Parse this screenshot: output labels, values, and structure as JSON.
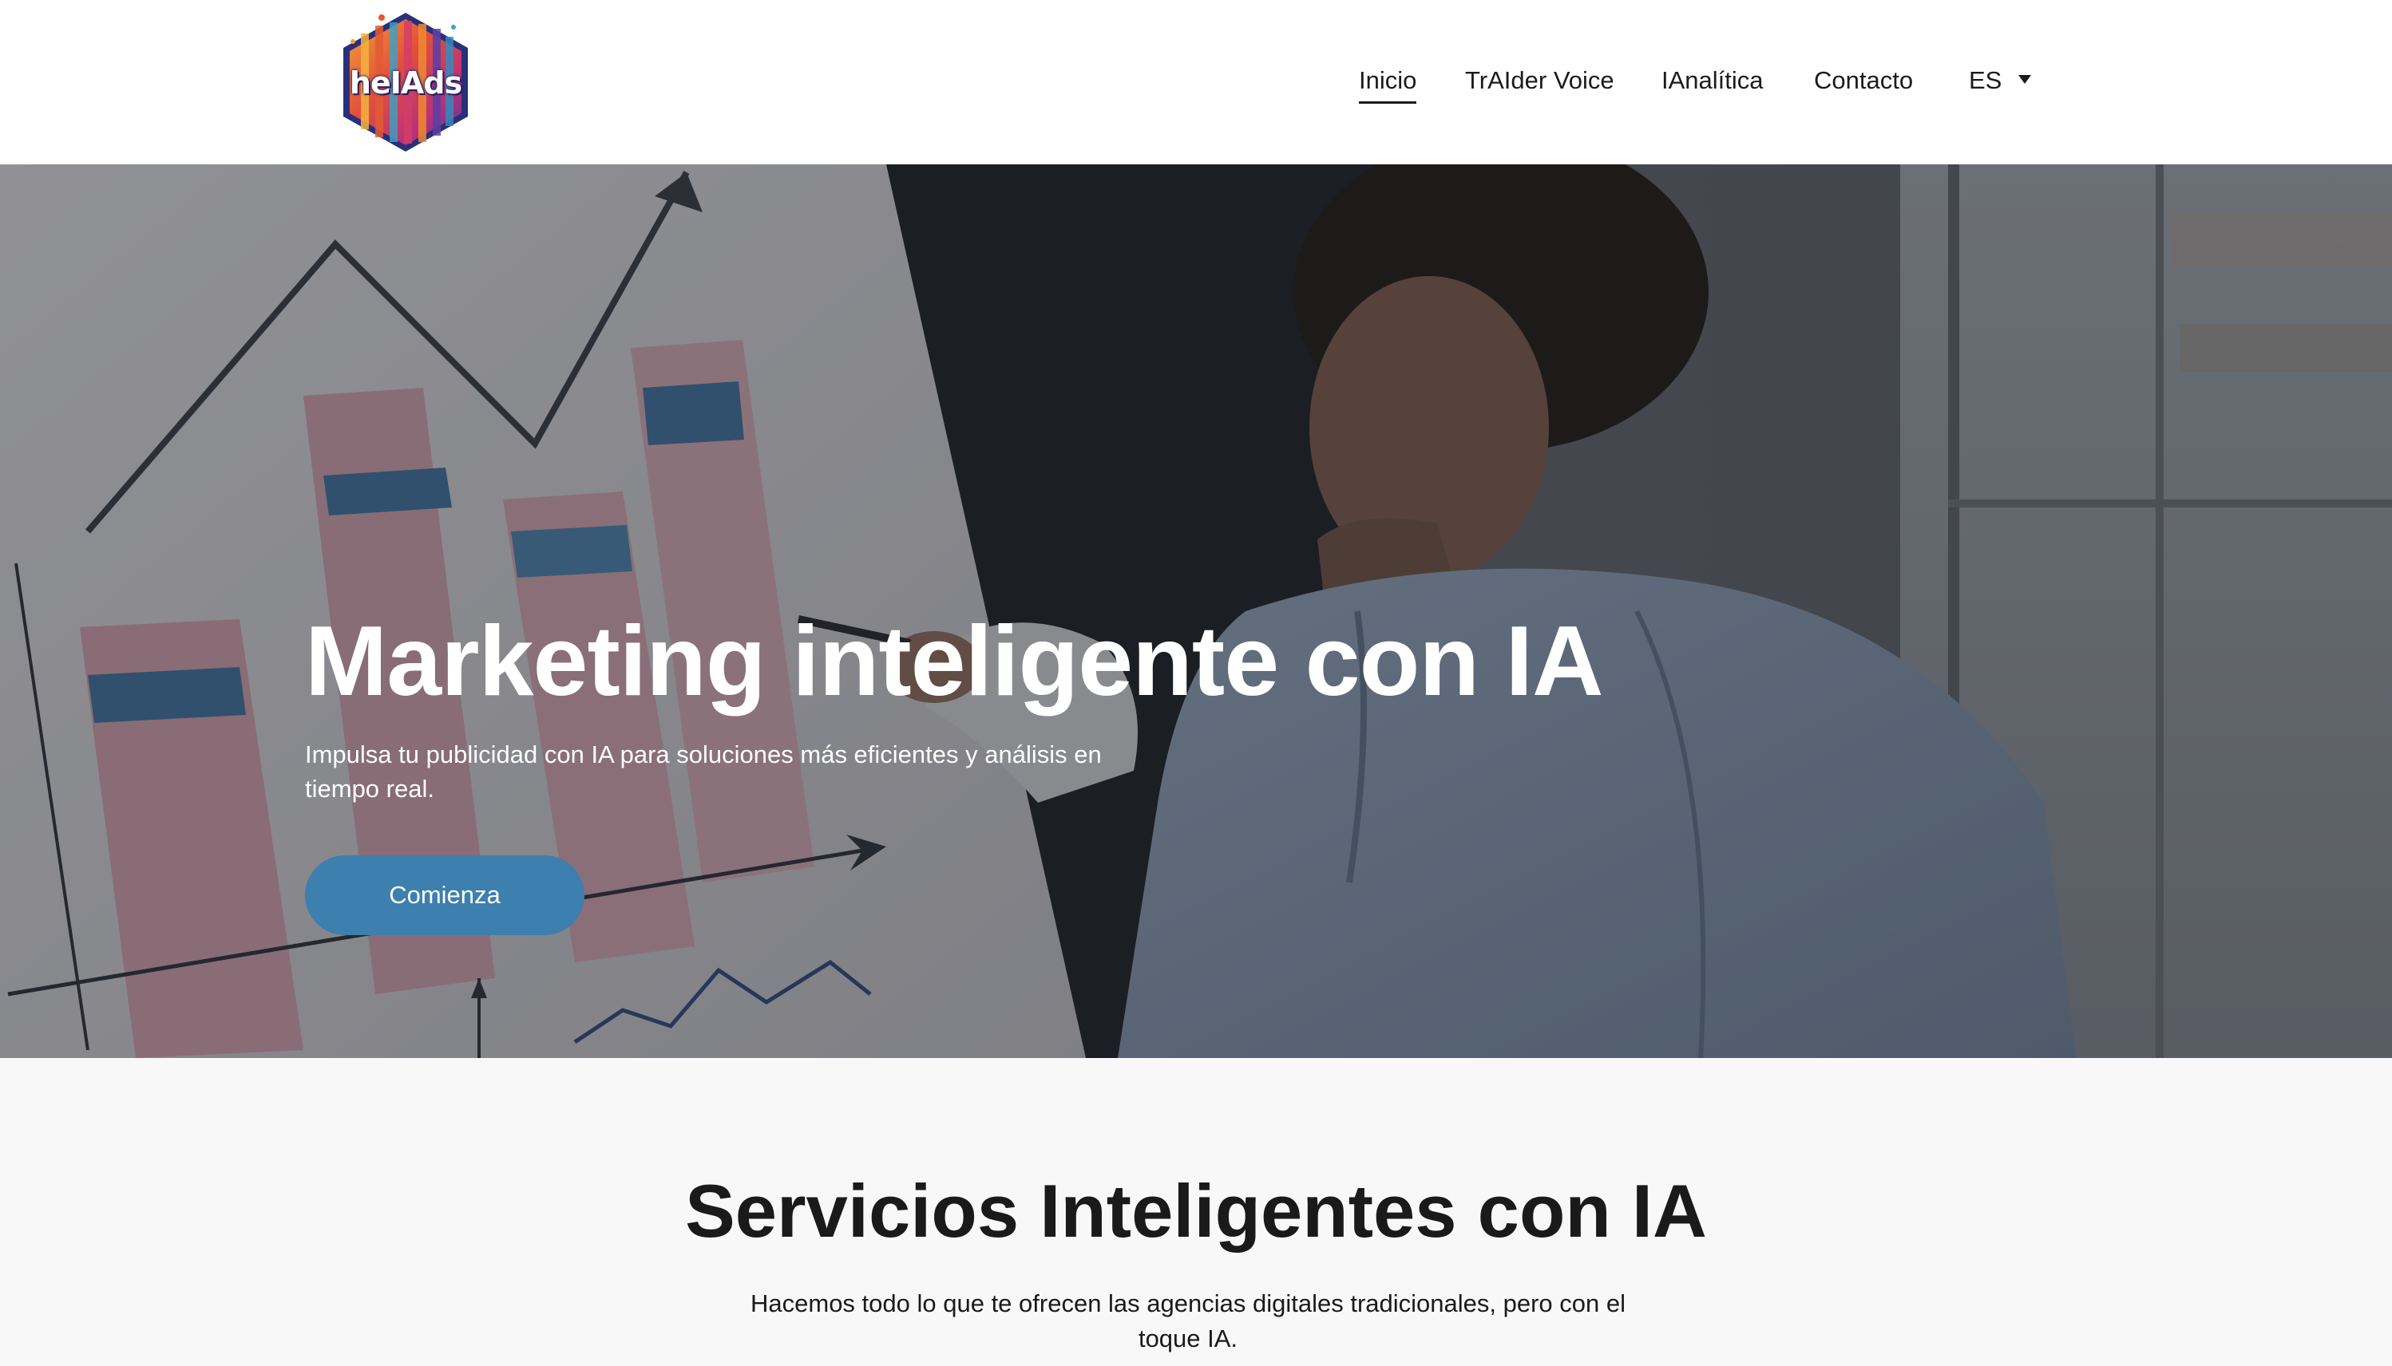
{
  "header": {
    "logo_text": "heIAds",
    "nav": [
      {
        "label": "Inicio",
        "active": true
      },
      {
        "label": "TrAIder Voice",
        "active": false
      },
      {
        "label": "IAnalítica",
        "active": false
      },
      {
        "label": "Contacto",
        "active": false
      }
    ],
    "language": {
      "selected": "ES"
    }
  },
  "hero": {
    "title": "Marketing inteligente con IA",
    "subtitle": "Impulsa tu publicidad con IA para soluciones más eficientes y análisis en tiempo real.",
    "cta_label": "Comienza",
    "cta_color": "#3d7fae"
  },
  "services": {
    "title": "Servicios Inteligentes con IA",
    "description": "Hacemos todo lo que te ofrecen las agencias digitales tradicionales, pero con el toque IA."
  },
  "colors": {
    "header_bg": "#ffffff",
    "page_bg": "#f8f8f8",
    "text_dark": "#1a1a1a"
  }
}
